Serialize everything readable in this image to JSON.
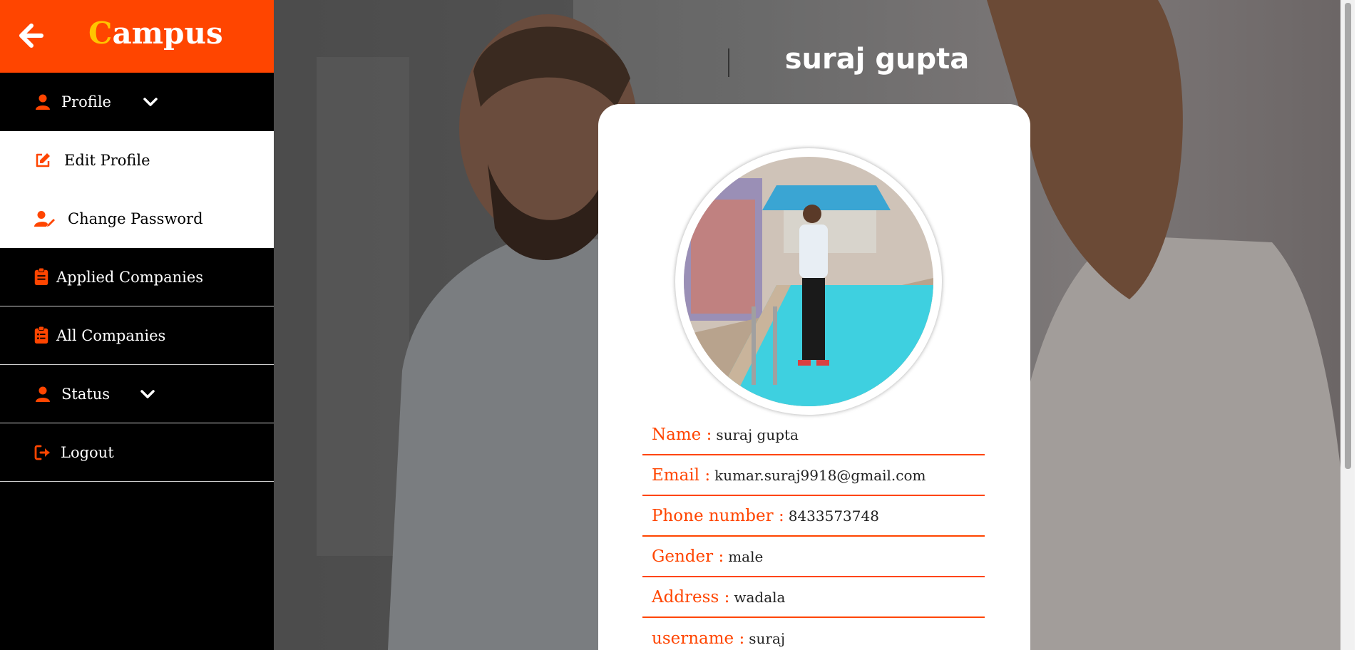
{
  "sidebar": {
    "brand_first": "C",
    "brand_rest": "ampus",
    "items": [
      {
        "label": "Profile"
      },
      {
        "label": "Edit Profile"
      },
      {
        "label": "Change Password"
      },
      {
        "label": "Applied Companies"
      },
      {
        "label": "All Companies"
      },
      {
        "label": "Status"
      },
      {
        "label": "Logout"
      }
    ]
  },
  "main": {
    "title": "suraj gupta",
    "fields": [
      {
        "key": "Name :",
        "value": "suraj gupta"
      },
      {
        "key": "Email :",
        "value": "kumar.suraj9918@gmail.com"
      },
      {
        "key": "Phone number :",
        "value": "8433573748"
      },
      {
        "key": "Gender :",
        "value": "male"
      },
      {
        "key": "Address :",
        "value": "wadala"
      },
      {
        "key": "username :",
        "value": "suraj"
      }
    ]
  },
  "colors": {
    "accent": "#ff4500",
    "brand_highlight": "#ffc400",
    "sidebar_bg": "#000000"
  },
  "icons": [
    "back-arrow-icon",
    "user-icon",
    "edit-icon",
    "user-edit-icon",
    "clipboard-icon",
    "clipboard-list-icon",
    "chevron-down-icon",
    "logout-icon"
  ]
}
